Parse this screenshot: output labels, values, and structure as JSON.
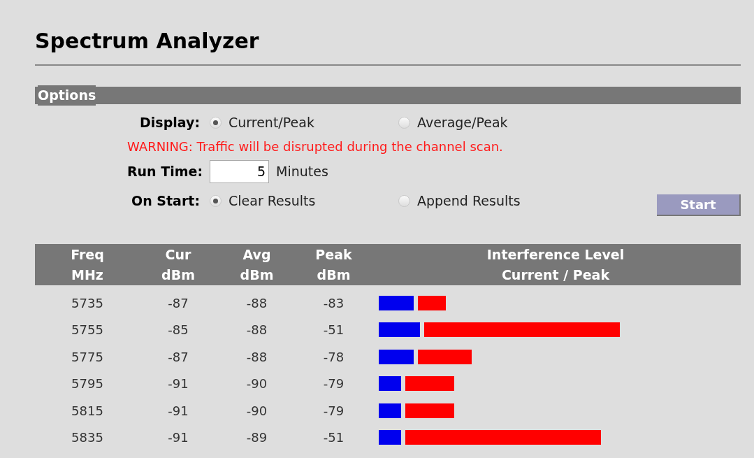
{
  "title": "Spectrum Analyzer",
  "options": {
    "heading": "Options",
    "display": {
      "label": "Display:",
      "choices": [
        {
          "label": "Current/Peak",
          "selected": true
        },
        {
          "label": "Average/Peak",
          "selected": false
        }
      ]
    },
    "warning": "WARNING: Traffic will be disrupted during the channel scan.",
    "run_time": {
      "label": "Run Time:",
      "value": "5",
      "unit": "Minutes"
    },
    "on_start": {
      "label": "On Start:",
      "choices": [
        {
          "label": "Clear Results",
          "selected": true
        },
        {
          "label": "Append Results",
          "selected": false
        }
      ]
    },
    "start_button": "Start"
  },
  "table": {
    "columns": [
      [
        "Freq",
        "MHz"
      ],
      [
        "Cur",
        "dBm"
      ],
      [
        "Avg",
        "dBm"
      ],
      [
        "Peak",
        "dBm"
      ],
      [
        "Interference Level",
        "Current / Peak"
      ]
    ],
    "rows": [
      {
        "freq": "5735",
        "cur": "-87",
        "avg": "-88",
        "peak": "-83"
      },
      {
        "freq": "5755",
        "cur": "-85",
        "avg": "-88",
        "peak": "-51"
      },
      {
        "freq": "5775",
        "cur": "-87",
        "avg": "-88",
        "peak": "-78"
      },
      {
        "freq": "5795",
        "cur": "-91",
        "avg": "-90",
        "peak": "-79"
      },
      {
        "freq": "5815",
        "cur": "-91",
        "avg": "-90",
        "peak": "-79"
      },
      {
        "freq": "5835",
        "cur": "-91",
        "avg": "-89",
        "peak": "-51"
      }
    ]
  }
}
